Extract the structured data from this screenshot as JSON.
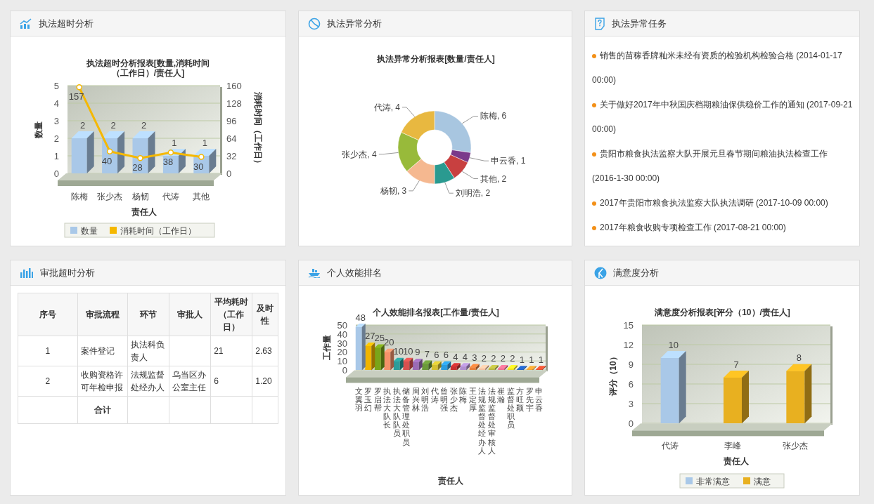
{
  "overtime_enforcement": {
    "title": "执法超时分析",
    "chart_data": [
      {
        "type": "bar",
        "title": "执法超时分析报表[数量,消耗时间（工作日）/责任人]",
        "xlabel": "责任人",
        "ylabel": "数量",
        "categories": [
          "陈梅",
          "张少杰",
          "杨韧",
          "代涛",
          "其他"
        ],
        "series": [
          {
            "name": "数量",
            "color": "#a9c8e8",
            "values": [
              2,
              2,
              2,
              1,
              1
            ]
          }
        ],
        "ylim": [
          0,
          5
        ],
        "yticks": [
          0,
          1,
          2,
          3,
          4,
          5
        ],
        "grid": true,
        "legend": "bottom",
        "data_labels": true
      },
      {
        "type": "line",
        "ylabel": "消耗时间（工作日）",
        "series": [
          {
            "name": "消耗时间（工作日）",
            "color": "#f5b800",
            "marker": "o",
            "values": [
              157,
              40,
              28,
              38,
              30
            ]
          }
        ],
        "ylim": [
          0,
          160
        ],
        "yticks": [
          0,
          32,
          64,
          96,
          128,
          160
        ],
        "data_labels": true
      }
    ]
  },
  "anomaly_enforcement": {
    "title": "执法异常分析",
    "chart_data": {
      "type": "donut",
      "title": "执法异常分析报表[数量/责任人]",
      "values": [
        6,
        1,
        2,
        2,
        3,
        4,
        4
      ],
      "colors": [
        "#a8c6e0",
        "#7a3a8a",
        "#c84040",
        "#2a9a90",
        "#f5b890",
        "#98ba3a",
        "#e8b840"
      ],
      "value_labels": [
        "陈梅, 6",
        "申云香, 1",
        "其他, 2",
        "刘明浩, 2",
        "杨韧, 3",
        "张少杰, 4",
        "代涛, 4"
      ]
    }
  },
  "anomaly_tasks": {
    "title": "执法异常任务",
    "items": [
      {
        "text": "销售的苗稼香牌籼米未经有资质的检验机构检验合格 (2014-01-17 00:00)"
      },
      {
        "text": "关于做好2017年中秋国庆档期粮油保供稳价工作的通知 (2017-09-21 00:00)"
      },
      {
        "text": "贵阳市粮食执法监察大队开展元旦春节期间粮油执法检查工作 (2016-1-30 00:00)"
      },
      {
        "text": "2017年贵阳市粮食执法监察大队执法调研 (2017-10-09 00:00)"
      },
      {
        "text": "2017年粮食收购专项检查工作 (2017-08-21 00:00)"
      }
    ]
  },
  "approval_overtime": {
    "title": "审批超时分析",
    "table": {
      "columns": [
        "序号",
        "审批流程",
        "环节",
        "审批人",
        "平均耗时（工作日）",
        "及时性"
      ],
      "rows": [
        [
          "1",
          "案件登记",
          "执法科负责人",
          null,
          "21",
          "2.63"
        ],
        [
          "2",
          "收购资格许可年检申报",
          "法规监督处经办人",
          "乌当区办公室主任",
          "6",
          "1.20"
        ]
      ],
      "total_label": "合计"
    }
  },
  "efficiency_ranking": {
    "title": "个人效能排名",
    "chart_data": {
      "type": "bar",
      "title": "个人效能排名报表[工作量/责任人]",
      "xlabel": "责任人",
      "ylabel": "工作量",
      "categories": [
        "文翼羽",
        "罗玉幻",
        "罗启帮",
        "执法大队长",
        "执法大队队员",
        "储备管理处职员",
        "周兴林",
        "刘明浩",
        "代涛",
        "曾明强",
        "张少杰",
        "陈梅",
        "王定厚",
        "法规监督处经办人",
        "法规监督处审核人",
        "崔瀚",
        "监督处职员",
        "方旺颖",
        "罗先宇",
        "申云香"
      ],
      "series": [
        {
          "color": "#a9c8e8",
          "values": [
            48,
            null,
            null,
            null,
            null,
            null,
            null,
            null,
            null,
            null,
            null,
            null,
            null,
            null,
            null,
            null,
            null,
            null,
            null,
            null
          ]
        },
        {
          "color": "#f0b400",
          "values": [
            null,
            27,
            null,
            null,
            null,
            null,
            null,
            null,
            null,
            null,
            null,
            null,
            null,
            null,
            null,
            null,
            null,
            null,
            null,
            null
          ]
        },
        {
          "color": "#7aa51a",
          "values": [
            null,
            null,
            25,
            null,
            null,
            null,
            null,
            null,
            null,
            null,
            null,
            null,
            null,
            null,
            null,
            null,
            null,
            null,
            null,
            null
          ]
        },
        {
          "color": "#f5916a",
          "values": [
            null,
            null,
            null,
            20,
            null,
            null,
            null,
            null,
            null,
            null,
            null,
            null,
            null,
            null,
            null,
            null,
            null,
            null,
            null,
            null
          ]
        },
        {
          "color": "#2a9d9a",
          "values": [
            null,
            null,
            null,
            null,
            10,
            null,
            null,
            null,
            null,
            null,
            null,
            null,
            null,
            null,
            null,
            null,
            null,
            null,
            null,
            null
          ]
        },
        {
          "color": "#d9504f",
          "values": [
            null,
            null,
            null,
            null,
            null,
            10,
            null,
            null,
            null,
            null,
            null,
            null,
            null,
            null,
            null,
            null,
            null,
            null,
            null,
            null
          ]
        },
        {
          "color": "#9a6bb5",
          "values": [
            null,
            null,
            null,
            null,
            null,
            null,
            9,
            null,
            null,
            null,
            null,
            null,
            null,
            null,
            null,
            null,
            null,
            null,
            null,
            null
          ]
        },
        {
          "color": "#6b9a3a",
          "values": [
            null,
            null,
            null,
            null,
            null,
            null,
            null,
            7,
            null,
            null,
            null,
            null,
            null,
            null,
            null,
            null,
            null,
            null,
            null,
            null
          ]
        },
        {
          "color": "#d4c030",
          "values": [
            null,
            null,
            null,
            null,
            null,
            null,
            null,
            null,
            6,
            null,
            null,
            null,
            null,
            null,
            null,
            null,
            null,
            null,
            null,
            null
          ]
        },
        {
          "color": "#2a9de0",
          "values": [
            null,
            null,
            null,
            null,
            null,
            null,
            null,
            null,
            null,
            6,
            null,
            null,
            null,
            null,
            null,
            null,
            null,
            null,
            null,
            null
          ]
        },
        {
          "color": "#c83030",
          "values": [
            null,
            null,
            null,
            null,
            null,
            null,
            null,
            null,
            null,
            null,
            4,
            null,
            null,
            null,
            null,
            null,
            null,
            null,
            null,
            null
          ]
        },
        {
          "color": "#b090d0",
          "values": [
            null,
            null,
            null,
            null,
            null,
            null,
            null,
            null,
            null,
            null,
            null,
            4,
            null,
            null,
            null,
            null,
            null,
            null,
            null,
            null
          ]
        },
        {
          "color": "#e8803a",
          "values": [
            null,
            null,
            null,
            null,
            null,
            null,
            null,
            null,
            null,
            null,
            null,
            null,
            3,
            null,
            null,
            null,
            null,
            null,
            null,
            null
          ]
        },
        {
          "color": "#f5c0a0",
          "values": [
            null,
            null,
            null,
            null,
            null,
            null,
            null,
            null,
            null,
            null,
            null,
            null,
            null,
            2,
            null,
            null,
            null,
            null,
            null,
            null
          ]
        },
        {
          "color": "#b8b840",
          "values": [
            null,
            null,
            null,
            null,
            null,
            null,
            null,
            null,
            null,
            null,
            null,
            null,
            null,
            null,
            2,
            null,
            null,
            null,
            null,
            null
          ]
        },
        {
          "color": "#f07090",
          "values": [
            null,
            null,
            null,
            null,
            null,
            null,
            null,
            null,
            null,
            null,
            null,
            null,
            null,
            null,
            null,
            2,
            null,
            null,
            null,
            null
          ]
        },
        {
          "color": "#f0e020",
          "values": [
            null,
            null,
            null,
            null,
            null,
            null,
            null,
            null,
            null,
            null,
            null,
            null,
            null,
            null,
            null,
            null,
            2,
            null,
            null,
            null
          ]
        },
        {
          "color": "#2060c0",
          "values": [
            null,
            null,
            null,
            null,
            null,
            null,
            null,
            null,
            null,
            null,
            null,
            null,
            null,
            null,
            null,
            null,
            null,
            1,
            null,
            null
          ]
        },
        {
          "color": "#f0a030",
          "values": [
            null,
            null,
            null,
            null,
            null,
            null,
            null,
            null,
            null,
            null,
            null,
            null,
            null,
            null,
            null,
            null,
            null,
            null,
            1,
            null
          ]
        },
        {
          "color": "#e05030",
          "values": [
            null,
            null,
            null,
            null,
            null,
            null,
            null,
            null,
            null,
            null,
            null,
            null,
            null,
            null,
            null,
            null,
            null,
            null,
            null,
            1
          ]
        }
      ],
      "ylim": [
        0,
        50
      ],
      "yticks": [
        0,
        10,
        20,
        30,
        40,
        50
      ],
      "grid": true,
      "data_labels": true
    }
  },
  "satisfaction": {
    "title": "满意度分析",
    "chart_data": {
      "type": "bar",
      "title": "满意度分析报表[评分（10）/责任人]",
      "xlabel": "责任人",
      "ylabel": "评分（10）",
      "categories": [
        "代涛",
        "李峰",
        "张少杰"
      ],
      "series": [
        {
          "name": "非常满意",
          "color": "#a9c8e8",
          "values": [
            10,
            null,
            null
          ]
        },
        {
          "name": "满意",
          "color": "#e8b020",
          "values": [
            null,
            7,
            8
          ]
        }
      ],
      "ylim": [
        0,
        15
      ],
      "yticks": [
        0,
        3,
        6,
        9,
        12,
        15
      ],
      "grid": true,
      "legend": "bottom",
      "data_labels": true
    }
  }
}
